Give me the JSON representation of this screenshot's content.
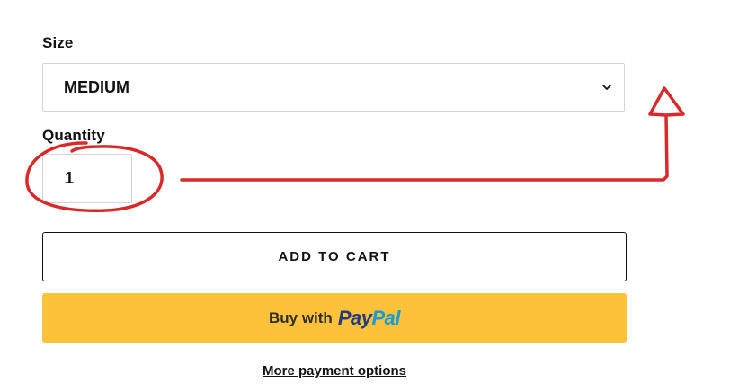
{
  "size": {
    "label": "Size",
    "selected": "MEDIUM",
    "chevron_icon": "chevron-down-icon"
  },
  "quantity": {
    "label": "Quantity",
    "value": "1"
  },
  "buttons": {
    "add_to_cart": "ADD TO CART",
    "paypal_prefix": "Buy with",
    "paypal_logo_pay": "Pay",
    "paypal_logo_pal": "Pal",
    "more_payment_options": "More payment options"
  },
  "colors": {
    "paypal_button": "#fcc23a",
    "paypal_dark_blue": "#253b80",
    "paypal_light_blue": "#179bd7",
    "annotation_red": "#d92a2a"
  }
}
